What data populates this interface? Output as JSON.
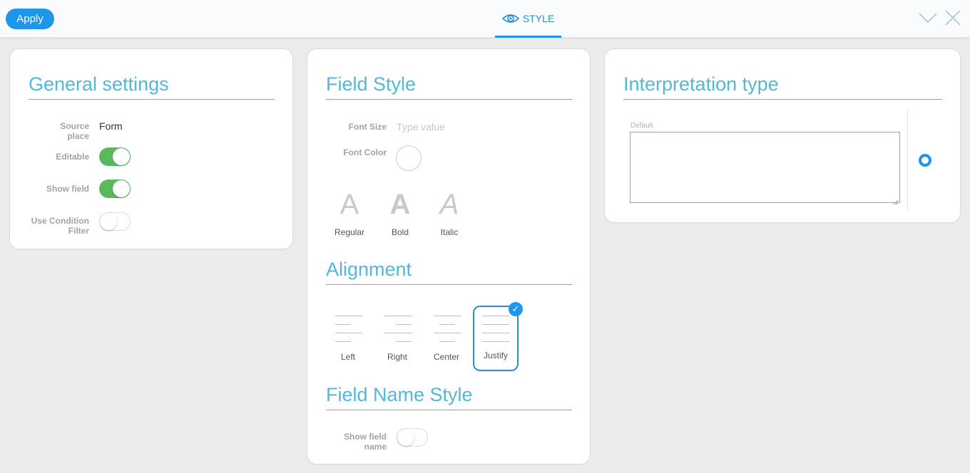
{
  "toolbar": {
    "apply_label": "Apply",
    "tab_label": "STYLE",
    "tab_icon": "eye-icon",
    "collapse_icon": "chevron-down-icon",
    "close_icon": "close-icon",
    "accent_color": "#1e96e9"
  },
  "general": {
    "title": "General settings",
    "source_place_label": "Source place",
    "source_place_value": "Form",
    "editable_label": "Editable",
    "editable_on": true,
    "show_field_label": "Show field",
    "show_field_on": true,
    "use_condition_label": "Use Condition Filter",
    "use_condition_on": false,
    "toggle_on_color": "#5cb85c"
  },
  "field_style": {
    "title": "Field Style",
    "font_size_label": "Font Size",
    "font_size_placeholder": "Type value",
    "font_color_label": "Font Color",
    "font_styles": [
      {
        "glyph": "A",
        "label": "Regular"
      },
      {
        "glyph": "A",
        "label": "Bold"
      },
      {
        "glyph": "A",
        "label": "Italic"
      }
    ]
  },
  "alignment": {
    "title": "Alignment",
    "options": [
      {
        "label": "Left"
      },
      {
        "label": "Right"
      },
      {
        "label": "Center"
      },
      {
        "label": "Justify"
      }
    ],
    "selected": "Justify"
  },
  "field_name_style": {
    "title": "Field Name Style",
    "show_field_name_label": "Show field name",
    "show_field_name_on": false
  },
  "interpretation": {
    "title": "Interpretation type",
    "default_label": "Default",
    "default_value": ""
  }
}
